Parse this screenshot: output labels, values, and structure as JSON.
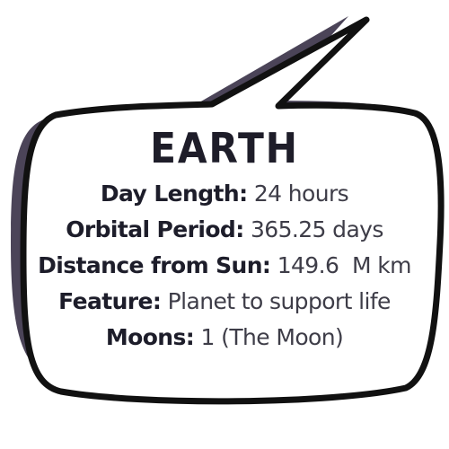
{
  "bubble": {
    "title": "EARTH",
    "facts": [
      {
        "label": "Day Length:",
        "value": "24 hours"
      },
      {
        "label": "Orbital Period:",
        "value": "365.25 days"
      },
      {
        "label": "Distance from Sun:",
        "value": "149.6  M km"
      },
      {
        "label": "Feature:",
        "value": "Planet to support life"
      },
      {
        "label": "Moons:",
        "value": "1 (The Moon)"
      }
    ]
  },
  "colors": {
    "outline": "#111111",
    "shadow": "#4b4458",
    "text_label": "#1d1d2a",
    "text_value": "#3e3d48",
    "fill": "#ffffff"
  }
}
